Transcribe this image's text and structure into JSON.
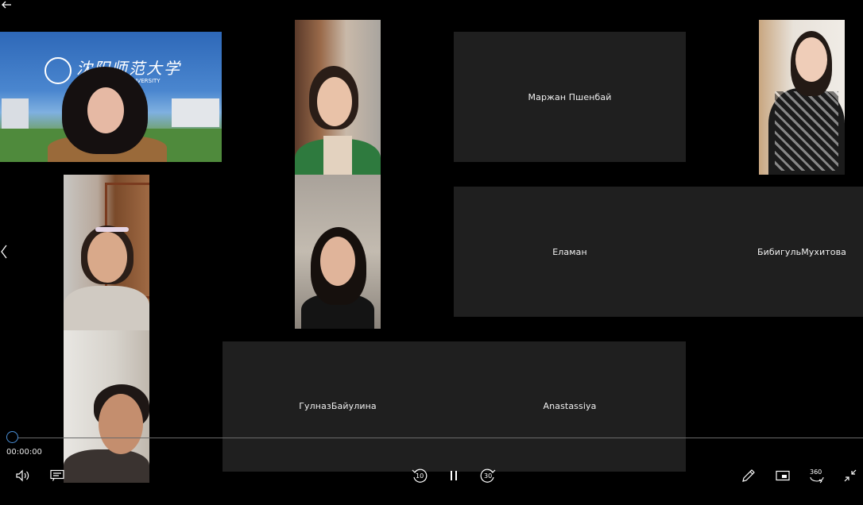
{
  "player": {
    "current_time": "00:00:00",
    "progress": 0,
    "rewind_label": "10",
    "forward_label": "30",
    "vr_label": "360"
  },
  "participants": {
    "banner_text": "沈阳师范大学",
    "banner_subtext": "UNIVERSITY",
    "marzhan": "Маржан Пшенбай",
    "elaman": "Еламан",
    "bibigul": "БибигульМухитова",
    "gulnaz": "ГулназБайулина",
    "anastassiya": "Anastassiya"
  },
  "icons": {
    "back": "arrow-left-icon",
    "prev": "chevron-left-icon",
    "volume": "volume-icon",
    "subtitles": "subtitles-icon",
    "rewind": "rewind-10-icon",
    "pause": "pause-icon",
    "forward": "forward-30-icon",
    "edit": "pencil-icon",
    "miniview": "mini-view-icon",
    "vr": "360-icon",
    "collapse": "exit-fullscreen-icon"
  },
  "colors": {
    "background": "#000000",
    "tile": "#1f1f1f",
    "accent": "#4a90d9",
    "text": "#ffffff"
  }
}
